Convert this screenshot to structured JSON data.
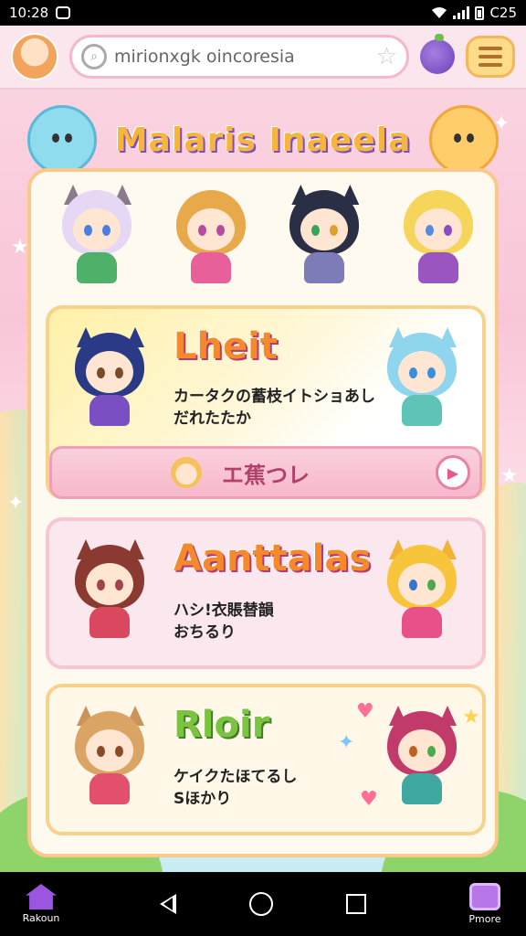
{
  "status_bar": {
    "time": "10:28",
    "battery_text": "C25"
  },
  "header": {
    "search_value": "mirionxgk oincoresia",
    "title": "Malaris Inaeela"
  },
  "cards": [
    {
      "title": "Lheit",
      "text_line1": "カータクの蓄枝イトショあし",
      "text_line2": "だれたたか",
      "button_label": "エ蕉つレ"
    },
    {
      "title": "Aanttalas",
      "text_line1": "ハシ!衣賬替韻",
      "text_line2": "おちるり"
    },
    {
      "title": "Rloir",
      "text_line1": "ケイクたほてるし",
      "text_line2": "Sほかり"
    }
  ],
  "bottom_nav": {
    "left_label": "Rakoun",
    "right_label": "Pmore"
  },
  "colors": {
    "accent_pink": "#f6b8ca",
    "accent_yellow": "#ffdc8a",
    "title_orange": "#f48a2c",
    "purple": "#9b55e0"
  }
}
